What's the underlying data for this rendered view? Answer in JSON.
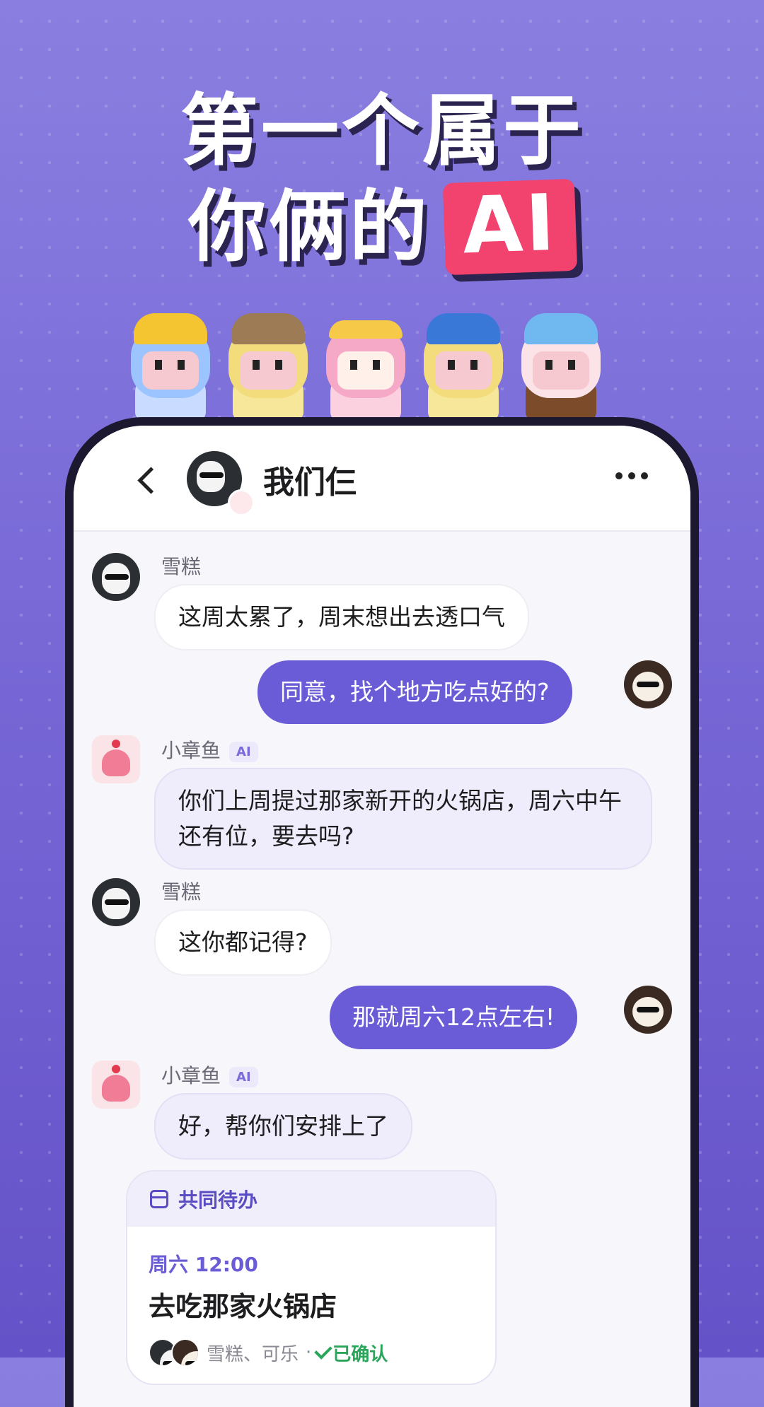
{
  "promo": {
    "headline_line1": "第一个属于",
    "headline_line2": "你俩的",
    "headline_badge": "AI"
  },
  "chat": {
    "title": "我们仨",
    "messages": [
      {
        "sender": "雪糕",
        "text": "这周太累了，周末想出去透口气",
        "side": "left",
        "avatar": "dog-avatar"
      },
      {
        "sender": "",
        "text": "同意，找个地方吃点好的?",
        "side": "right",
        "avatar": "cat-avatar"
      },
      {
        "sender": "小章鱼",
        "ai_tag": "AI",
        "text": "你们上周提过那家新开的火锅店，周六中午还有位，要去吗?",
        "side": "left",
        "avatar": "octopus-avatar"
      },
      {
        "sender": "雪糕",
        "text": "这你都记得?",
        "side": "left",
        "avatar": "dog-avatar"
      },
      {
        "sender": "",
        "text": "那就周六12点左右!",
        "side": "right",
        "avatar": "cat-avatar"
      },
      {
        "sender": "小章鱼",
        "ai_tag": "AI",
        "text": "好，帮你们安排上了",
        "side": "left",
        "avatar": "octopus-avatar"
      }
    ],
    "todo_card": {
      "header": "共同待办",
      "time": "周六 12:00",
      "title": "去吃那家火锅店",
      "participants": "雪糕、可乐",
      "separator": "·",
      "status": "已确认"
    }
  },
  "colors": {
    "background": "#7a6bd8",
    "accent": "#6a5bd6",
    "ai_badge": "#f2426e",
    "confirm": "#2aa65a"
  }
}
